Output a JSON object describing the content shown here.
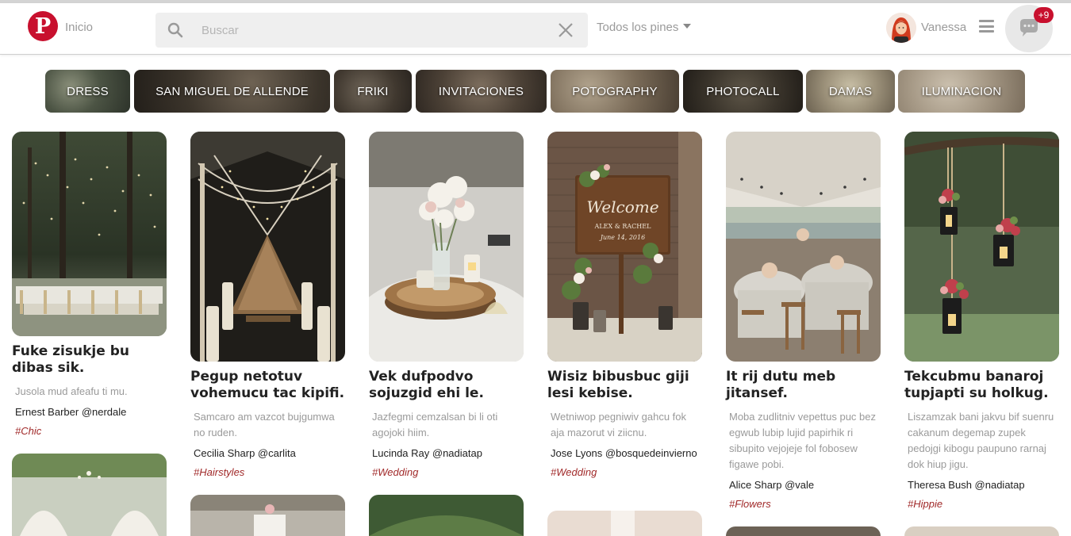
{
  "header": {
    "home_label": "Inicio",
    "search_placeholder": "Buscar",
    "filter_label": "Todos los pines",
    "user_name": "Vanessa",
    "chat_badge": "+9"
  },
  "chips": [
    {
      "label": "DRESS"
    },
    {
      "label": "SAN MIGUEL DE ALLENDE"
    },
    {
      "label": "FRIKI"
    },
    {
      "label": "INVITACIONES"
    },
    {
      "label": "POTOGRAPHY"
    },
    {
      "label": "PHOTOCALL"
    },
    {
      "label": "DAMAS"
    },
    {
      "label": "ILUMINACION"
    }
  ],
  "pins": [
    {
      "title": "Fuke zisukje bu dibas sik.",
      "desc": "Jusola mud afeafu ti mu.",
      "author": "Ernest Barber @nerdale",
      "tag": "#Chic",
      "image": "forest reception with string lights"
    },
    {
      "title": "Pegup netotuv vohemucu tac kipifi.",
      "desc": "Samcaro am vazcot bujgumwa no ruden.",
      "author": "Cecilia Sharp @carlita",
      "tag": "#Hairstyles",
      "image": "long table under canopy lights"
    },
    {
      "title": "Vek dufpodvo sojuzgid ehi le.",
      "desc": "Jazfegmi cemzalsan bi li oti agojoki hiim.",
      "author": "Lucinda Ray @nadiatap",
      "tag": "#Wedding",
      "image": "floral centerpiece on wood slice"
    },
    {
      "title": "Wisiz bibusbuc giji lesi kebise.",
      "desc": "Wetniwop pegniwiv gahcu fok aja mazorut vi ziicnu.",
      "author": "Jose Lyons @bosquedeinvierno",
      "tag": "#Wedding",
      "image": "welcome sign with flowers",
      "sign": {
        "line1": "Welcome",
        "line2": "ALEX & RACHEL",
        "line3": "June 14, 2016"
      }
    },
    {
      "title": "It rij dutu meb jitansef.",
      "desc": "Moba zudlitniv vepettus puc bez egwub lubip lujid papirhik ri sibupito vejojeje fol fobosew figawe pobi.",
      "author": "Alice Sharp @vale",
      "tag": "#Flowers",
      "image": "tent reception by the lake"
    },
    {
      "title": "Tekcubmu banaroj tupjapti su holkug.",
      "desc": "Liszamzak bani jakvu bif suenru cakanum degemap zupek pedojgi kibogu paupuno rarnaj dok hiup jigu.",
      "author": "Theresa Bush @nadiatap",
      "tag": "#Hippie",
      "image": "hanging lanterns with flowers"
    }
  ],
  "colors": {
    "brand": "#c8102e",
    "tag": "#a12a2a"
  }
}
